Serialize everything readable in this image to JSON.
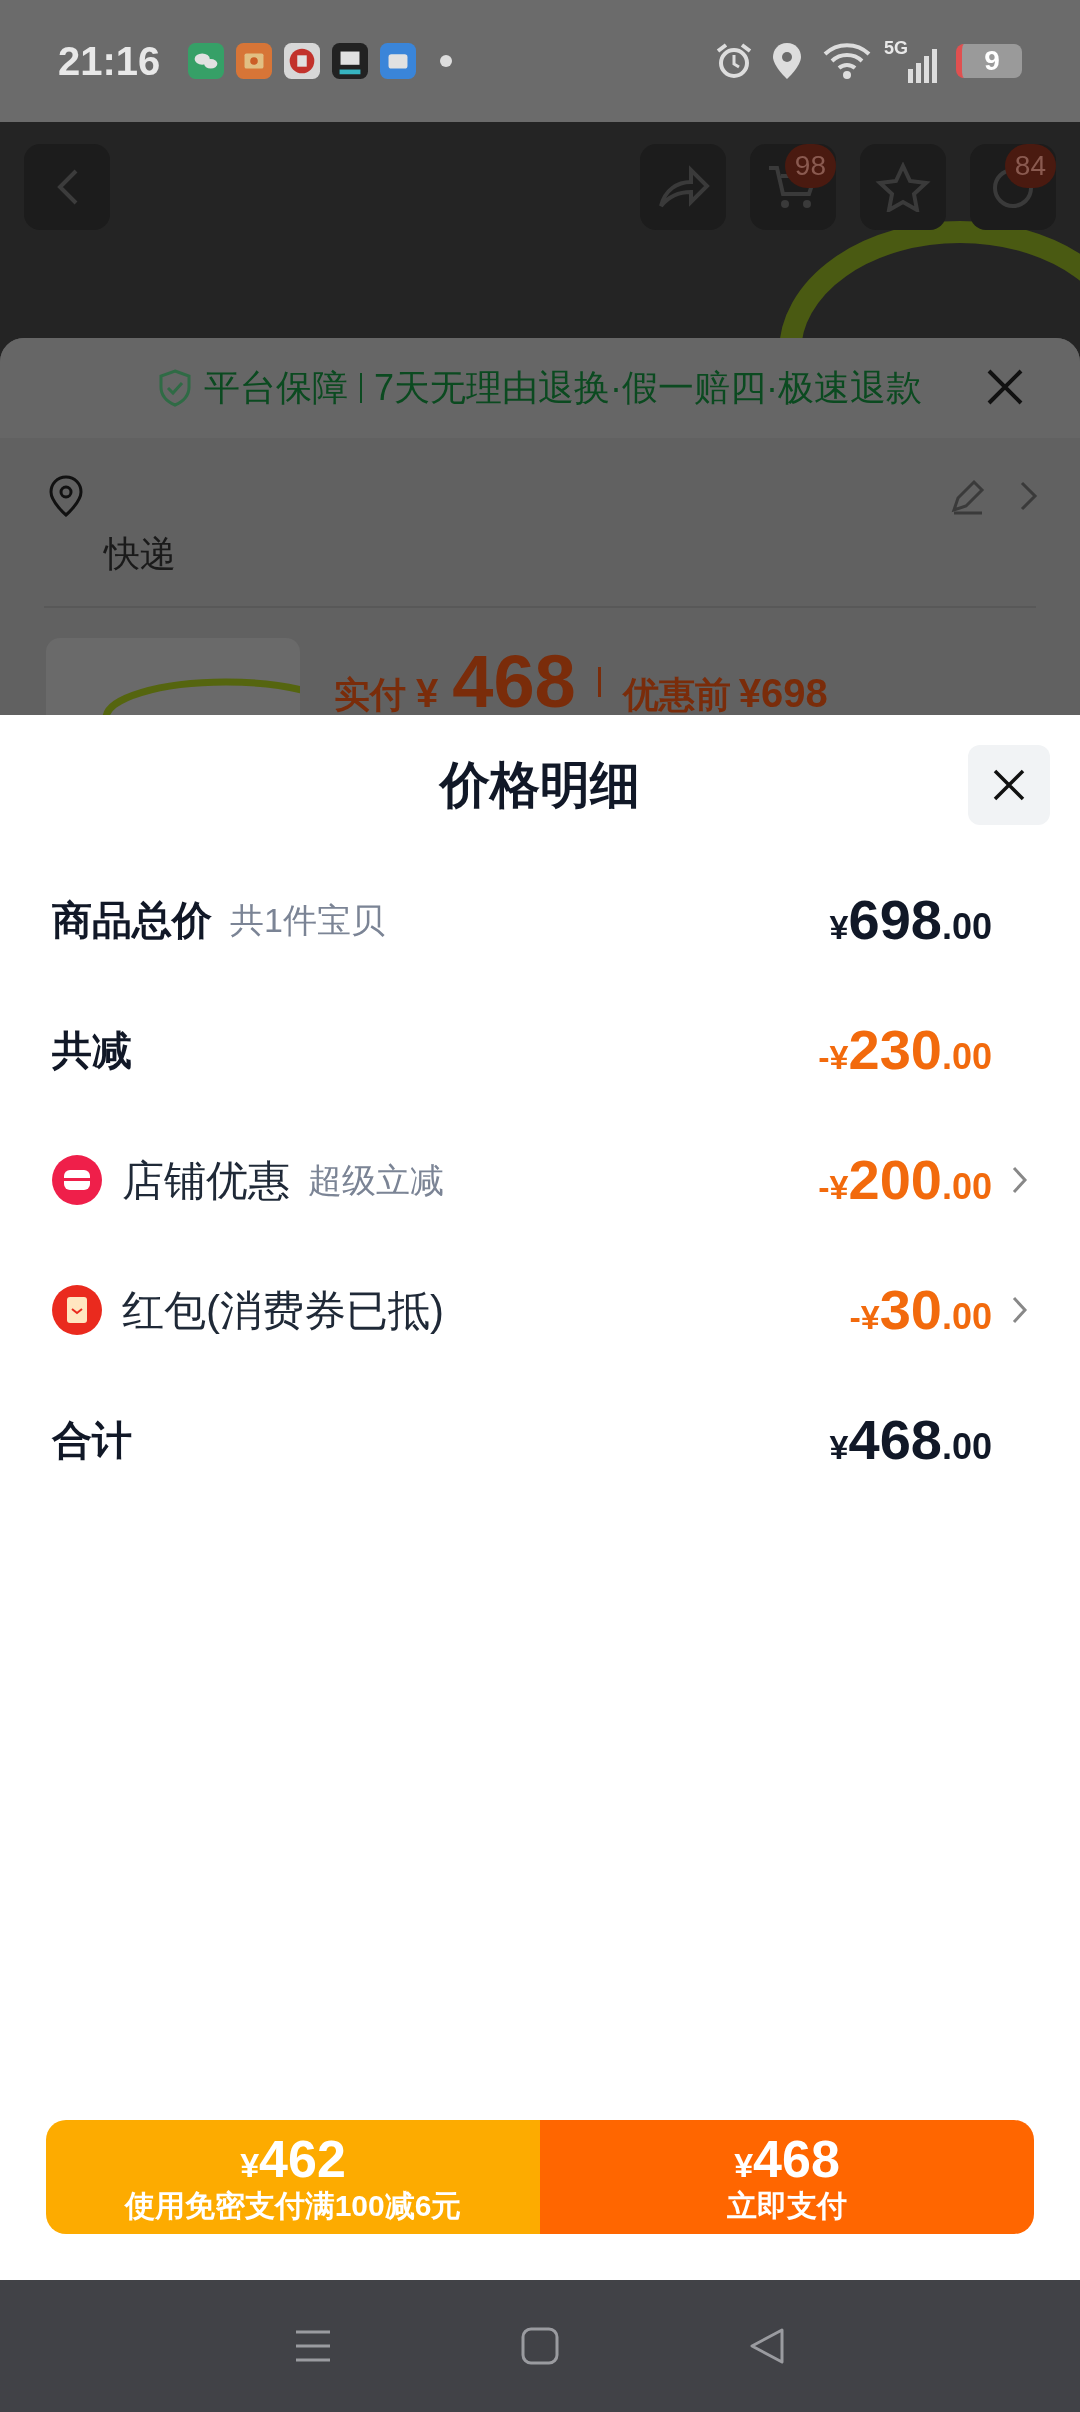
{
  "status_bar": {
    "time": "21:16",
    "network": "5G",
    "battery": "9"
  },
  "background_page": {
    "cart_badge": "98",
    "message_badge": "84",
    "guarantee": {
      "label": "平台保障",
      "text": "7天无理由退换·假一赔四·极速退款"
    },
    "delivery": "快递",
    "price": {
      "paid_label": "实付",
      "currency": "¥",
      "paid_amount": "468",
      "original_label": "优惠前",
      "original": "¥698"
    }
  },
  "price_detail": {
    "title": "价格明细",
    "rows": [
      {
        "kind": "line",
        "label": "商品总价",
        "note": "共1件宝贝",
        "prefix": "¥",
        "amount": "698",
        "decimals": ".00",
        "discount": false,
        "has_detail": false
      },
      {
        "kind": "line",
        "label": "共减",
        "prefix": "-¥",
        "amount": "230",
        "decimals": ".00",
        "discount": true,
        "has_detail": false
      },
      {
        "kind": "shop",
        "label": "店铺优惠",
        "note": "超级立减",
        "prefix": "-¥",
        "amount": "200",
        "decimals": ".00",
        "discount": true,
        "has_detail": true
      },
      {
        "kind": "redpacket",
        "label": "红包(消费券已抵)",
        "prefix": "-¥",
        "amount": "30",
        "decimals": ".00",
        "discount": true,
        "has_detail": true
      },
      {
        "kind": "line",
        "label": "合计",
        "prefix": "¥",
        "amount": "468",
        "decimals": ".00",
        "discount": false,
        "has_detail": false
      }
    ]
  },
  "pay_buttons": [
    {
      "kind": "secondary",
      "currency": "¥",
      "amount": "462",
      "label": "使用免密支付满100减6元"
    },
    {
      "kind": "primary",
      "currency": "¥",
      "amount": "468",
      "label": "立即支付"
    }
  ]
}
